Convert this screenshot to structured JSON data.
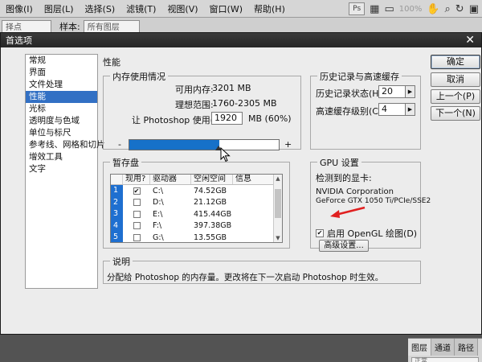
{
  "menubar": {
    "items": [
      "图像(I)",
      "图层(L)",
      "选择(S)",
      "滤镜(T)",
      "视图(V)",
      "窗口(W)",
      "帮助(H)"
    ],
    "right": {
      "zoom": "100%",
      "ps_badge": "Ps"
    }
  },
  "optbar": {
    "field1": "择点",
    "sample_label": "样本:",
    "sample_value": "所有图层"
  },
  "dialog": {
    "title": "首选项",
    "categories": [
      "常规",
      "界面",
      "文件处理",
      "性能",
      "光标",
      "透明度与色域",
      "单位与标尺",
      "参考线、网格和切片",
      "增效工具",
      "文字"
    ],
    "selected_category": "性能",
    "section_title": "性能",
    "memory": {
      "group_label": "内存使用情况",
      "available_label": "可用内存:",
      "available_value": "3201 MB",
      "ideal_label": "理想范围:",
      "ideal_value": "1760-2305 MB",
      "use_label": "让 Photoshop 使用(L):",
      "use_value": "1920",
      "use_suffix": "MB (60%)",
      "slider_fraction": 0.6,
      "minus": "-",
      "plus": "+"
    },
    "history": {
      "group_label": "历史记录与高速缓存",
      "states_label": "历史记录状态(H):",
      "states_value": "20",
      "cache_label": "高速缓存级别(C):",
      "cache_value": "4"
    },
    "scratch": {
      "group_label": "暂存盘",
      "columns": [
        "现用?",
        "驱动器",
        "空闲空间",
        "信息"
      ],
      "rows": [
        {
          "index": "1",
          "active": true,
          "drive": "C:\\",
          "free": "74.52GB",
          "info": ""
        },
        {
          "index": "2",
          "active": false,
          "drive": "D:\\",
          "free": "21.12GB",
          "info": ""
        },
        {
          "index": "3",
          "active": false,
          "drive": "E:\\",
          "free": "415.44GB",
          "info": ""
        },
        {
          "index": "4",
          "active": false,
          "drive": "F:\\",
          "free": "397.38GB",
          "info": ""
        },
        {
          "index": "5",
          "active": false,
          "drive": "G:\\",
          "free": "13.55GB",
          "info": ""
        }
      ]
    },
    "gpu": {
      "group_label": "GPU 设置",
      "detected_label": "检测到的显卡:",
      "card_line1": "NVIDIA Corporation",
      "card_line2": "GeForce GTX 1050 Ti/PCIe/SSE2",
      "opengl_label": "启用 OpenGL 绘图(D)",
      "opengl_checked": true,
      "advanced_button": "高级设置..."
    },
    "description": {
      "group_label": "说明",
      "text": "分配给 Photoshop 的内存量。更改将在下一次启动 Photoshop 时生效。"
    },
    "buttons": {
      "ok": "确定",
      "reset": "取消",
      "prev": "上一个(P)",
      "next": "下一个(N)"
    }
  },
  "side_panel": {
    "tabs": [
      "图层",
      "通道",
      "路径"
    ],
    "field": "正常"
  },
  "colors": {
    "accent": "#1671c9",
    "selected": "#3270c4",
    "arrow": "#e02020"
  }
}
